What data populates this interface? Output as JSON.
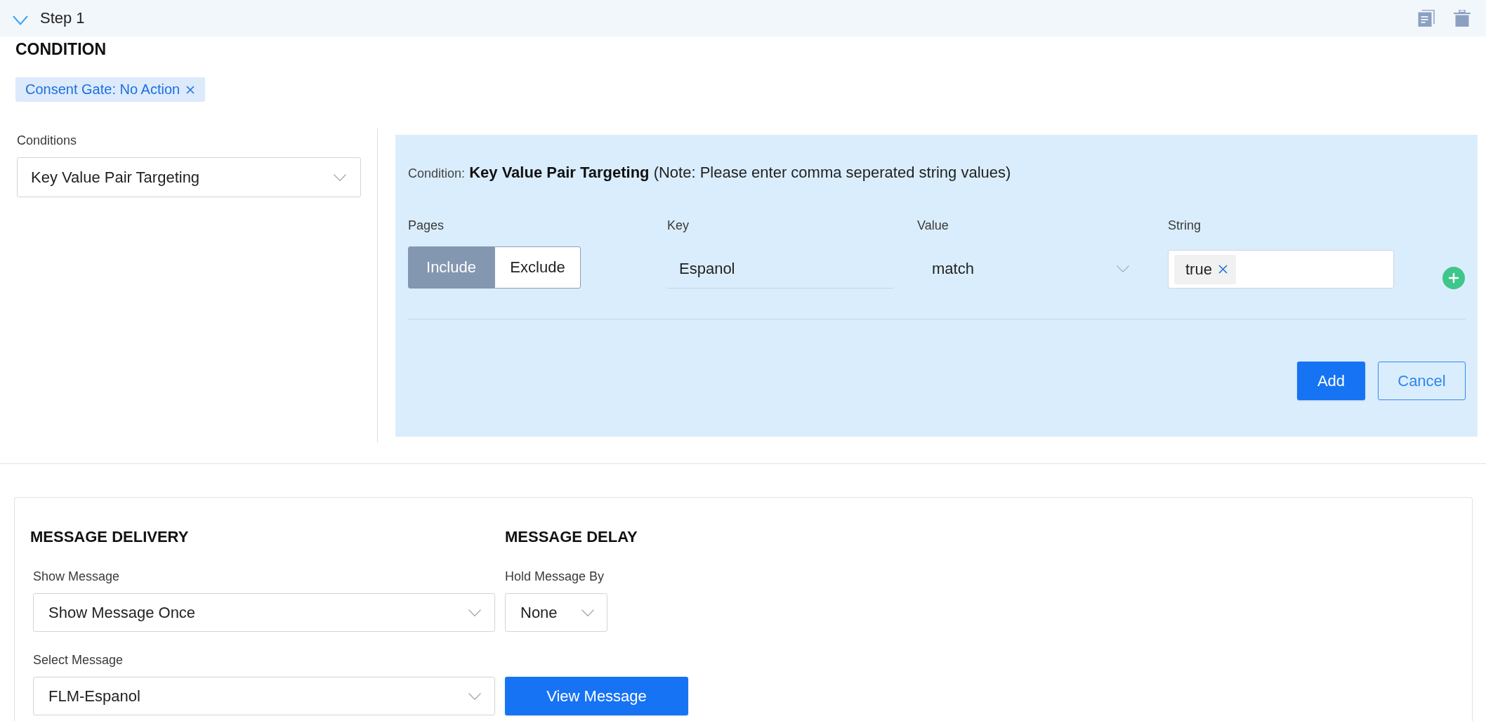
{
  "step": {
    "title": "Step 1",
    "expanded": true
  },
  "condition": {
    "heading": "CONDITION",
    "chips": [
      {
        "label": "Consent Gate: No Action"
      }
    ]
  },
  "conditions_field": {
    "label": "Conditions",
    "value": "Key Value Pair Targeting"
  },
  "condition_panel": {
    "prefix": "Condition:",
    "name": "Key Value Pair Targeting",
    "note": "(Note: Please enter comma seperated string values)",
    "pages": {
      "label": "Pages",
      "options": [
        {
          "label": "Include",
          "selected": true
        },
        {
          "label": "Exclude",
          "selected": false
        }
      ]
    },
    "key": {
      "label": "Key",
      "value": "Espanol"
    },
    "value": {
      "label": "Value",
      "value": "match"
    },
    "string": {
      "label": "String",
      "tags": [
        {
          "label": "true"
        }
      ]
    },
    "buttons": [
      {
        "label": "Add",
        "kind": "primary"
      },
      {
        "label": "Cancel",
        "kind": "secondary"
      }
    ]
  },
  "message_delivery": {
    "heading": "MESSAGE DELIVERY",
    "show_message": {
      "label": "Show Message",
      "value": "Show Message Once"
    },
    "select_message": {
      "label": "Select Message",
      "value": "FLM-Espanol"
    }
  },
  "message_delay": {
    "heading": "MESSAGE DELAY",
    "hold_message_by": {
      "label": "Hold Message By",
      "value": "None"
    }
  },
  "view_message_button": {
    "label": "View Message"
  }
}
